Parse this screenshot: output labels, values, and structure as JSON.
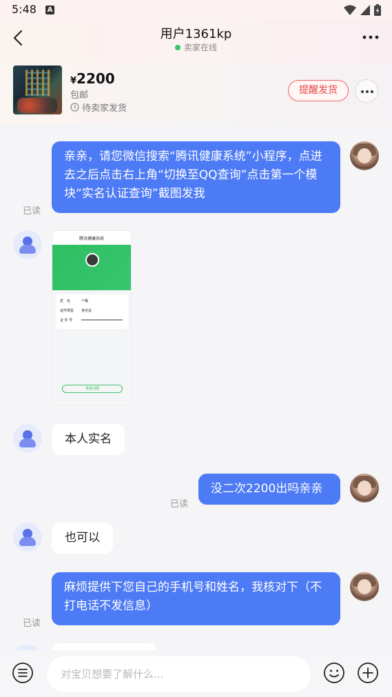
{
  "status_bar": {
    "time": "5:48",
    "badge": "A",
    "icons": [
      "wifi-icon",
      "signal-icon",
      "battery-icon"
    ]
  },
  "header": {
    "title": "用户1361kp",
    "online_status": "卖家在线"
  },
  "product": {
    "currency": "¥",
    "price": "2200",
    "shipping": "包邮",
    "status": "待卖家发货",
    "remind_button": "提醒发货"
  },
  "messages": [
    {
      "from": "me",
      "text": "亲亲，请您微信搜索“腾讯健康系统”小程序，点进去之后点击右上角“切换至QQ查询”点击第一个模块“实名认证查询”截图发我",
      "read": "已读"
    },
    {
      "from": "seller",
      "type": "image",
      "title": "腾讯健康系统",
      "labels": [
        "姓　名",
        "证件类型",
        "证 件 号"
      ],
      "values": [
        "**薰",
        "身份证"
      ],
      "button": "查看问题"
    },
    {
      "from": "seller",
      "text": "本人实名"
    },
    {
      "from": "me",
      "text": "没二次2200出吗亲亲",
      "read": "已读"
    },
    {
      "from": "seller",
      "text": "也可以"
    },
    {
      "from": "me",
      "text": "麻烦提供下您自己的手机号和姓名，我核对下（不打电话不发信息）",
      "read": "已读"
    }
  ],
  "composer": {
    "placeholder": "对宝贝想要了解什么..."
  },
  "colors": {
    "accent": "#4d7af5",
    "online": "#3dc46a",
    "remind": "#e84545"
  }
}
